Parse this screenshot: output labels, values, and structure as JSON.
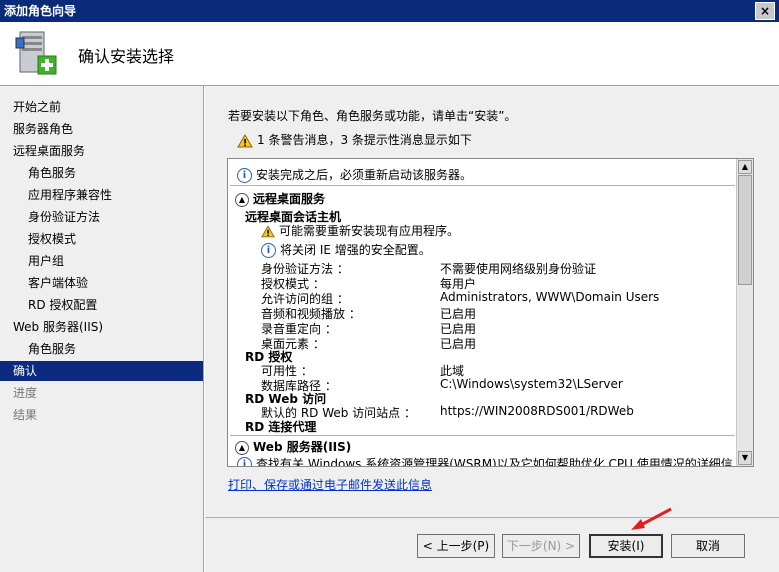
{
  "window": {
    "title": "添加角色向导",
    "close": "×"
  },
  "header": {
    "title": "确认安装选择"
  },
  "sidebar": {
    "items": [
      {
        "label": "开始之前",
        "level": "top",
        "state": "normal"
      },
      {
        "label": "服务器角色",
        "level": "top",
        "state": "normal"
      },
      {
        "label": "远程桌面服务",
        "level": "top",
        "state": "normal"
      },
      {
        "label": "角色服务",
        "level": "sub",
        "state": "normal"
      },
      {
        "label": "应用程序兼容性",
        "level": "sub",
        "state": "normal"
      },
      {
        "label": "身份验证方法",
        "level": "sub",
        "state": "normal"
      },
      {
        "label": "授权模式",
        "level": "sub",
        "state": "normal"
      },
      {
        "label": "用户组",
        "level": "sub",
        "state": "normal"
      },
      {
        "label": "客户端体验",
        "level": "sub",
        "state": "normal"
      },
      {
        "label": "RD 授权配置",
        "level": "sub",
        "state": "normal"
      },
      {
        "label": "Web 服务器(IIS)",
        "level": "top",
        "state": "normal"
      },
      {
        "label": "角色服务",
        "level": "sub",
        "state": "normal"
      },
      {
        "label": "确认",
        "level": "top",
        "state": "active"
      },
      {
        "label": "进度",
        "level": "top",
        "state": "dim"
      },
      {
        "label": "结果",
        "level": "top",
        "state": "dim"
      }
    ]
  },
  "main": {
    "intro": "若要安装以下角色、角色服务或功能，请单击“安装”。",
    "warning_summary": "1 条警告消息，3 条提示性消息显示如下",
    "details": {
      "restart_info": "安装完成之后，必须重新启动该服务器。",
      "section_rds": "远程桌面服务",
      "rdsh_title": "远程桌面会话主机",
      "rdsh_warning": "可能需要重新安装现有应用程序。",
      "rdsh_info": "将关闭 IE 增强的安全配置。",
      "props": [
        {
          "k": "身份验证方法 ：",
          "v": "不需要使用网络级别身份验证"
        },
        {
          "k": "授权模式 ：",
          "v": "每用户"
        },
        {
          "k": "允许访问的组 ：",
          "v": "Administrators, WWW\\Domain Users"
        },
        {
          "k": "音频和视频播放 ：",
          "v": "已启用"
        },
        {
          "k": "录音重定向 ：",
          "v": "已启用"
        },
        {
          "k": "桌面元素 ：",
          "v": "已启用"
        }
      ],
      "rd_license_title": "RD 授权",
      "rd_license_props": [
        {
          "k": "可用性 ：",
          "v": "此域"
        },
        {
          "k": "数据库路径 ：",
          "v": "C:\\Windows\\system32\\LServer"
        }
      ],
      "rd_web_title": "RD Web 访问",
      "rd_web_props": [
        {
          "k": "默认的 RD Web 访问站点 ：",
          "v": "https://WIN2008RDS001/RDWeb"
        }
      ],
      "rd_gateway_title": "RD 连接代理",
      "section_iis": "Web 服务器(IIS)",
      "iis_info": "查找有关 Windows 系统资源管理器(WSRM)以及它如何帮助优化 CPU 使用情况的详细信"
    },
    "link": "打印、保存或通过电子邮件发送此信息"
  },
  "buttons": {
    "prev": "< 上一步(P)",
    "next": "下一步(N) >",
    "install": "安装(I)",
    "cancel": "取消"
  },
  "colors": {
    "titlebar": "#0a2a7a",
    "active": "#0b2a80",
    "annotation_arrow": "#e02020"
  }
}
